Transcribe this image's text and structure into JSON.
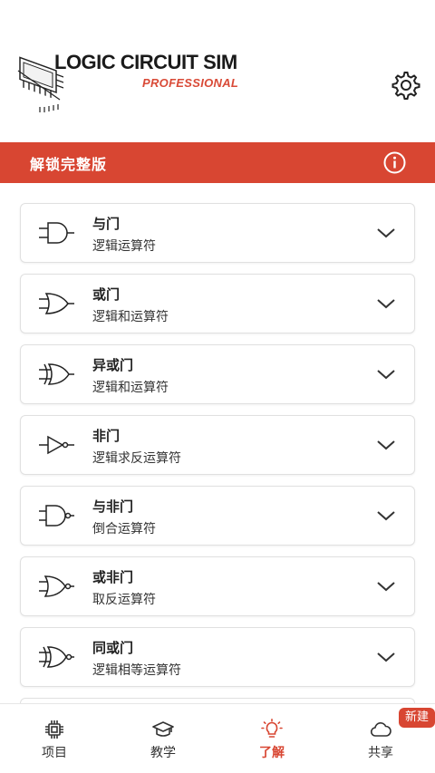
{
  "app": {
    "logo_title": "LOGIC CIRCUIT SIM",
    "logo_subtitle": "PROFESSIONAL"
  },
  "banner": {
    "label": "解锁完整版"
  },
  "gates": [
    {
      "title": "与门",
      "subtitle": "逻辑运算符",
      "icon": "and-gate-icon"
    },
    {
      "title": "或门",
      "subtitle": "逻辑和运算符",
      "icon": "or-gate-icon"
    },
    {
      "title": "异或门",
      "subtitle": "逻辑和运算符",
      "icon": "xor-gate-icon"
    },
    {
      "title": "非门",
      "subtitle": "逻辑求反运算符",
      "icon": "not-gate-icon"
    },
    {
      "title": "与非门",
      "subtitle": "倒合运算符",
      "icon": "nand-gate-icon"
    },
    {
      "title": "或非门",
      "subtitle": "取反运算符",
      "icon": "nor-gate-icon"
    },
    {
      "title": "同或门",
      "subtitle": "逻辑相等运算符",
      "icon": "xnor-gate-icon"
    }
  ],
  "tabs": [
    {
      "label": "项目",
      "icon": "chip-icon",
      "active": false
    },
    {
      "label": "教学",
      "icon": "graduation-cap-icon",
      "active": false
    },
    {
      "label": "了解",
      "icon": "lightbulb-icon",
      "active": true
    },
    {
      "label": "共享",
      "icon": "cloud-icon",
      "active": false
    }
  ],
  "share_badge": "新建",
  "colors": {
    "accent": "#d84632",
    "text": "#222222",
    "border": "#e0e0e0"
  }
}
